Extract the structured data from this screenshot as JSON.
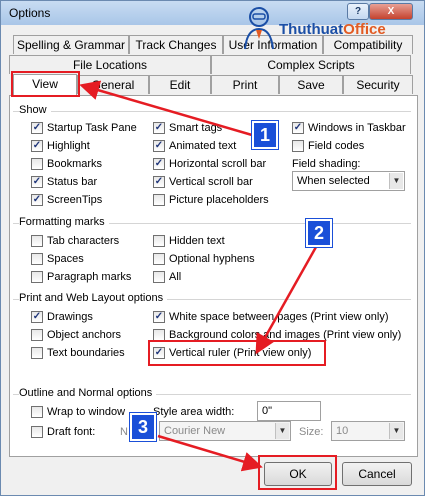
{
  "window": {
    "title": "Options",
    "help_glyph": "?",
    "close_glyph": "X"
  },
  "logo": {
    "part1": "Thuthuat",
    "part2": "Office"
  },
  "tabs": {
    "row1": [
      "Spelling & Grammar",
      "Track Changes",
      "User Information",
      "Compatibility"
    ],
    "row2": [
      "File Locations",
      "Complex Scripts"
    ],
    "row3": [
      "View",
      "General",
      "Edit",
      "Print",
      "Save",
      "Security"
    ]
  },
  "show": {
    "heading": "Show",
    "items": [
      {
        "label": "Startup Task Pane",
        "checked": true
      },
      {
        "label": "Smart tags",
        "checked": true
      },
      {
        "label": "Windows in Taskbar",
        "checked": true
      },
      {
        "label": "Highlight",
        "checked": true
      },
      {
        "label": "Animated text",
        "checked": true
      },
      {
        "label": "Field codes",
        "checked": false
      },
      {
        "label": "Bookmarks",
        "checked": false
      },
      {
        "label": "Horizontal scroll bar",
        "checked": true
      },
      {
        "label": "Status bar",
        "checked": true
      },
      {
        "label": "Vertical scroll bar",
        "checked": true
      },
      {
        "label": "ScreenTips",
        "checked": true
      },
      {
        "label": "Picture placeholders",
        "checked": false
      }
    ],
    "field_shading_label": "Field shading:",
    "field_shading_value": "When selected"
  },
  "formatting": {
    "heading": "Formatting marks",
    "items": [
      {
        "label": "Tab characters",
        "checked": false
      },
      {
        "label": "Hidden text",
        "checked": false
      },
      {
        "label": "Spaces",
        "checked": false
      },
      {
        "label": "Optional hyphens",
        "checked": false
      },
      {
        "label": "Paragraph marks",
        "checked": false
      },
      {
        "label": "All",
        "checked": false
      }
    ]
  },
  "print_layout": {
    "heading": "Print and Web Layout options",
    "items": [
      {
        "label": "Drawings",
        "checked": true
      },
      {
        "label": "White space between pages (Print view only)",
        "checked": true
      },
      {
        "label": "Object anchors",
        "checked": false
      },
      {
        "label": "Background colors and images (Print view only)",
        "checked": false
      },
      {
        "label": "Text boundaries",
        "checked": false
      },
      {
        "label": "Vertical ruler (Print view only)",
        "checked": true
      }
    ]
  },
  "outline": {
    "heading": "Outline and Normal options",
    "wrap_label": "Wrap to window",
    "wrap_checked": false,
    "style_area_label": "Style area width:",
    "style_area_value": "0\"",
    "draft_label": "Draft font:",
    "draft_checked": false,
    "name_label": "N",
    "font_value": "Courier New",
    "size_label": "Size:",
    "size_value": "10"
  },
  "buttons": {
    "ok": "OK",
    "cancel": "Cancel"
  },
  "badges": [
    "1",
    "2",
    "3"
  ],
  "colors": {
    "annotation_red": "#e51c23",
    "badge_blue": "#1a4fd8"
  }
}
